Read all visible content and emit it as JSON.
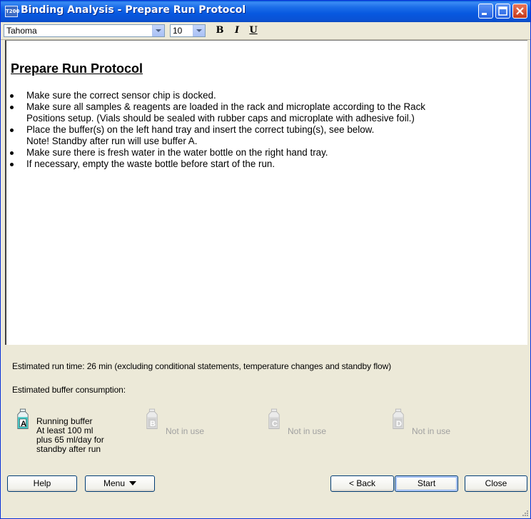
{
  "window": {
    "title": "Binding Analysis - Prepare Run Protocol",
    "app_badge": "T200"
  },
  "toolbar": {
    "font": "Tahoma",
    "size": "10",
    "bold": "B",
    "italic": "I",
    "underline": "U"
  },
  "document": {
    "title": "Prepare Run Protocol",
    "items": [
      {
        "lines": [
          "Make sure the correct sensor chip is docked."
        ]
      },
      {
        "lines": [
          "Make sure all samples & reagents are loaded in the rack and microplate according to the Rack",
          "Positions setup. (Vials should be sealed with rubber caps and microplate with adhesive foil.)"
        ]
      },
      {
        "lines": [
          "Place the buffer(s) on the left hand tray and insert the correct tubing(s), see below.",
          "Note! Standby after run will use buffer A."
        ]
      },
      {
        "lines": [
          "Make sure there is fresh water in the water bottle on the right hand tray."
        ]
      },
      {
        "lines": [
          "If necessary, empty the waste bottle before start of the run."
        ]
      }
    ]
  },
  "summary": {
    "run_time": "Estimated run time:  26 min  (excluding conditional statements, temperature changes and standby flow)",
    "consumption_label": "Estimated buffer consumption:"
  },
  "bottles": [
    {
      "letter": "A",
      "lines": [
        "Running buffer",
        "At least 100 ml",
        "plus 65 ml/day for",
        "standby after run"
      ],
      "active": true,
      "color": "#3cc7c4"
    },
    {
      "letter": "B",
      "lines": [
        "Not in use"
      ],
      "active": false,
      "color": "#d8d8d8"
    },
    {
      "letter": "C",
      "lines": [
        "Not in use"
      ],
      "active": false,
      "color": "#d8d8d8"
    },
    {
      "letter": "D",
      "lines": [
        "Not in use"
      ],
      "active": false,
      "color": "#d8d8d8"
    }
  ],
  "buttons": {
    "help": "Help",
    "menu": "Menu",
    "back": "< Back",
    "start": "Start",
    "close": "Close"
  }
}
